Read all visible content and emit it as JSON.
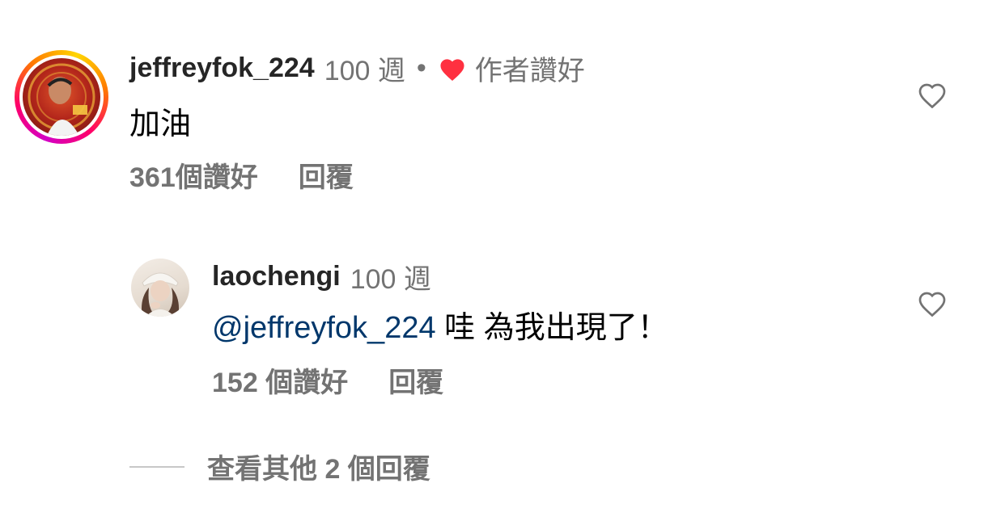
{
  "comment": {
    "username": "jeffreyfok_224",
    "age": "100 週",
    "separator": "•",
    "author_liked_label": "作者讚好",
    "text": "加油",
    "likes_label": "361個讚好",
    "reply_label": "回覆",
    "avatar_ring": true
  },
  "reply": {
    "username": "laochengi",
    "age": "100 週",
    "mention": "@jeffreyfok_224",
    "text": " 哇 為我出現了！",
    "likes_label": "152 個讚好",
    "reply_label": "回覆"
  },
  "view_more_replies_label": "查看其他 2 個回覆",
  "colors": {
    "username": "#262626",
    "meta": "#737373",
    "mention": "#00376b",
    "liked_heart": "#ff3040",
    "heart_outline": "#737373"
  },
  "icons": {
    "author_liked": "filled-heart-icon",
    "like_button": "heart-outline-icon"
  }
}
